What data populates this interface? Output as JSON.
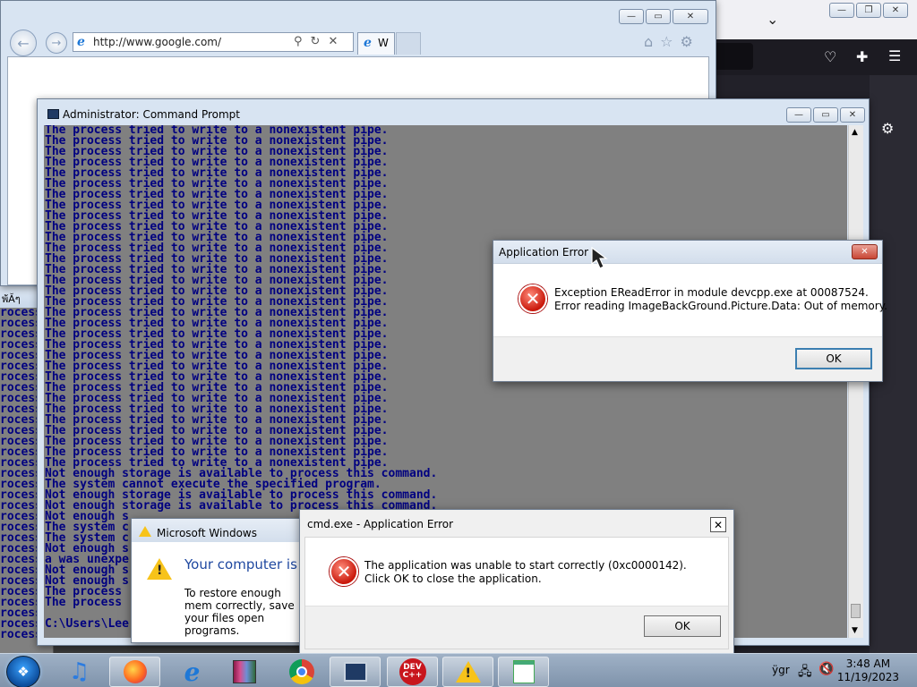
{
  "ie": {
    "url": "http://www.google.com/",
    "tab_label": "W"
  },
  "thai": {
    "title": "พ้Ăๆ",
    "lines": [
      "rocess",
      "rocess",
      "rocess",
      "rocess",
      "rocess",
      "rocess",
      "rocess",
      "rocess",
      "rocess",
      "rocess",
      "rocess",
      "rocess",
      "rocess",
      "rocess",
      "rocess",
      "rocess",
      "rocess",
      "rocess",
      "rocess",
      "rocess",
      "rocess",
      "rocess",
      "rocess",
      "rocess",
      "rocess",
      "rocess",
      "rocess",
      "rocess",
      "rocess",
      "rocess",
      "rocess"
    ]
  },
  "cmd": {
    "title": "Administrator: Command Prompt",
    "lines": [
      "The process tried to write to a nonexistent pipe.",
      "The process tried to write to a nonexistent pipe.",
      "The process tried to write to a nonexistent pipe.",
      "The process tried to write to a nonexistent pipe.",
      "The process tried to write to a nonexistent pipe.",
      "The process tried to write to a nonexistent pipe.",
      "The process tried to write to a nonexistent pipe.",
      "The process tried to write to a nonexistent pipe.",
      "The process tried to write to a nonexistent pipe.",
      "The process tried to write to a nonexistent pipe.",
      "The process tried to write to a nonexistent pipe.",
      "The process tried to write to a nonexistent pipe.",
      "The process tried to write to a nonexistent pipe.",
      "The process tried to write to a nonexistent pipe.",
      "The process tried to write to a nonexistent pipe.",
      "The process tried to write to a nonexistent pipe.",
      "The process tried to write to a nonexistent pipe.",
      "The process tried to write to a nonexistent pipe.",
      "The process tried to write to a nonexistent pipe.",
      "The process tried to write to a nonexistent pipe.",
      "The process tried to write to a nonexistent pipe.",
      "The process tried to write to a nonexistent pipe.",
      "The process tried to write to a nonexistent pipe.",
      "The process tried to write to a nonexistent pipe.",
      "The process tried to write to a nonexistent pipe.",
      "The process tried to write to a nonexistent pipe.",
      "The process tried to write to a nonexistent pipe.",
      "The process tried to write to a nonexistent pipe.",
      "The process tried to write to a nonexistent pipe.",
      "The process tried to write to a nonexistent pipe.",
      "The process tried to write to a nonexistent pipe.",
      "The process tried to write to a nonexistent pipe.",
      "Not enough storage is available to process this command.",
      "The system cannot execute the specified program.",
      "Not enough storage is available to process this command.",
      "Not enough storage is available to process this command.",
      "Not enough s",
      "The system c",
      "The system c",
      "Not enough s",
      "a was unexpe",
      "Not enough s",
      "Not enough s",
      "The process",
      "The process",
      "",
      "C:\\Users\\Lee"
    ]
  },
  "app_error": {
    "title": "Application Error",
    "line1": "Exception EReadError in module devcpp.exe at 00087524.",
    "line2": "Error reading ImageBackGround.Picture.Data: Out of memory.",
    "ok": "OK"
  },
  "ms_windows": {
    "title": "Microsoft Windows",
    "heading": "Your computer is l",
    "body": "To restore enough mem correctly, save your files open programs."
  },
  "cmd_error": {
    "title": "cmd.exe - Application Error",
    "message": "The application was unable to start correctly (0xc0000142). Click OK to close the application.",
    "ok": "OK"
  },
  "taskbar": {
    "time": "3:48 AM",
    "date": "11/19/2023",
    "lang": "ÿgr",
    "devcpp_label": "DEV C++"
  }
}
